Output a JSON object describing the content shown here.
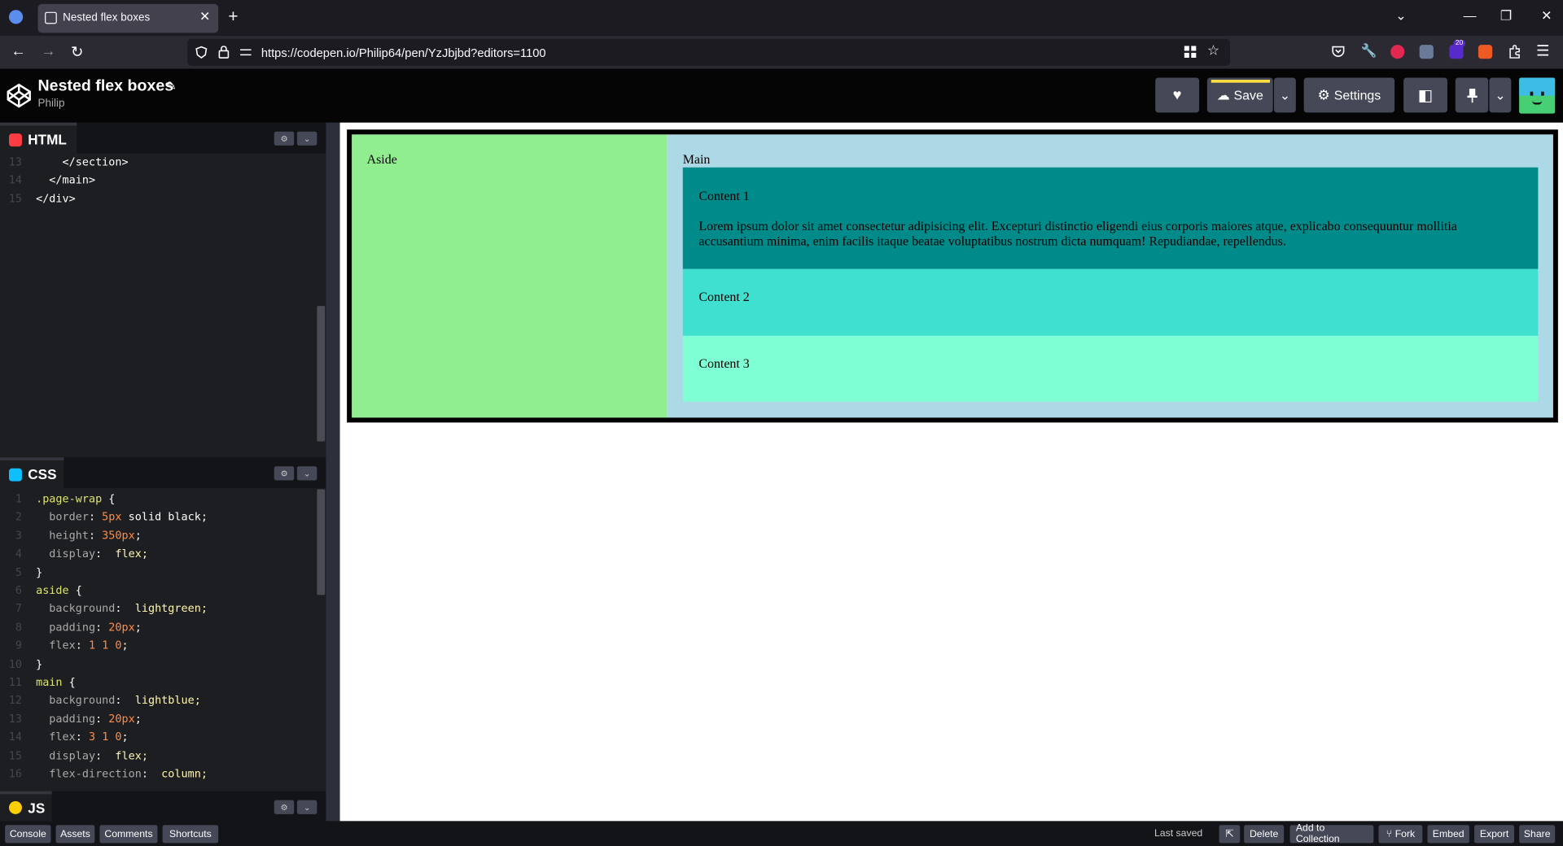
{
  "browser": {
    "tab_title": "Nested flex boxes",
    "tab_close": "✕",
    "new_tab": "+",
    "tabs_menu": "⌄",
    "minimize": "—",
    "restore": "❐",
    "close_window": "✕",
    "url": "https://codepen.io/Philip64/pen/YzJbjbd?editors=1100",
    "back": "←",
    "forward": "→",
    "reload": "↻",
    "extension_badge": "20",
    "menu": "☰"
  },
  "header": {
    "pen_title": "Nested flex boxes",
    "edit_icon": "✎",
    "author": "Philip",
    "love": "♥",
    "save_label": "Save",
    "save_icon": "☁",
    "dropdown": "⌄",
    "settings_label": "Settings",
    "settings_icon": "⚙",
    "layout_icon": "◧",
    "pin_icon": "📌"
  },
  "editors": {
    "html": {
      "label": "HTML",
      "icon_color": "#ff3c41",
      "lines": [
        {
          "n": "13",
          "text": "    </section>"
        },
        {
          "n": "14",
          "text": "  </main>"
        },
        {
          "n": "15",
          "text": "</div>"
        }
      ]
    },
    "css": {
      "label": "CSS",
      "icon_color": "#0ebeff",
      "lines": [
        {
          "n": "1",
          "sel": ".page-wrap",
          "rest": " {"
        },
        {
          "n": "2",
          "prop": "  border",
          "val": "5px",
          "rest": " solid black;"
        },
        {
          "n": "3",
          "prop": "  height",
          "val": "350px",
          "rest": ";"
        },
        {
          "n": "4",
          "prop": "  display",
          "rest": " flex;"
        },
        {
          "n": "5",
          "rest": "}"
        },
        {
          "n": "6",
          "sel": "aside",
          "rest": " {"
        },
        {
          "n": "7",
          "prop": "  background",
          "rest": " lightgreen;"
        },
        {
          "n": "8",
          "prop": "  padding",
          "val": "20px",
          "rest": ";"
        },
        {
          "n": "9",
          "prop": "  flex",
          "val": "1 1 0",
          "rest": ";"
        },
        {
          "n": "10",
          "rest": "}"
        },
        {
          "n": "11",
          "sel": "main",
          "rest": " {"
        },
        {
          "n": "12",
          "prop": "  background",
          "rest": " lightblue;"
        },
        {
          "n": "13",
          "prop": "  padding",
          "val": "20px",
          "rest": ";"
        },
        {
          "n": "14",
          "prop": "  flex",
          "val": "3 1 0",
          "rest": ";"
        },
        {
          "n": "15",
          "prop": "  display",
          "rest": " flex;"
        },
        {
          "n": "16",
          "prop": "  flex-direction",
          "rest": " column;"
        }
      ]
    },
    "js": {
      "label": "JS",
      "icon_color": "#fcd000"
    },
    "settings_icon": "⚙",
    "collapse_icon": "⌄"
  },
  "preview": {
    "aside": "Aside",
    "main": "Main",
    "content1": "Content 1",
    "paragraph": "Lorem ipsum dolor sit amet consectetur adipisicing elit. Excepturi distinctio eligendi eius corporis maiores atque, explicabo consequuntur mollitia accusantium minima, enim facilis itaque beatae voluptatibus nostrum dicta numquam! Repudiandae, repellendus.",
    "content2": "Content 2",
    "content3": "Content 3"
  },
  "footer": {
    "console": "Console",
    "assets": "Assets",
    "comments": "Comments",
    "shortcuts": "Shortcuts",
    "last_saved": "Last saved",
    "external": "⇱",
    "delete": "Delete",
    "add_to_collection": "Add to Collection",
    "fork": "Fork",
    "embed": "Embed",
    "export": "Export",
    "share": "Share"
  }
}
